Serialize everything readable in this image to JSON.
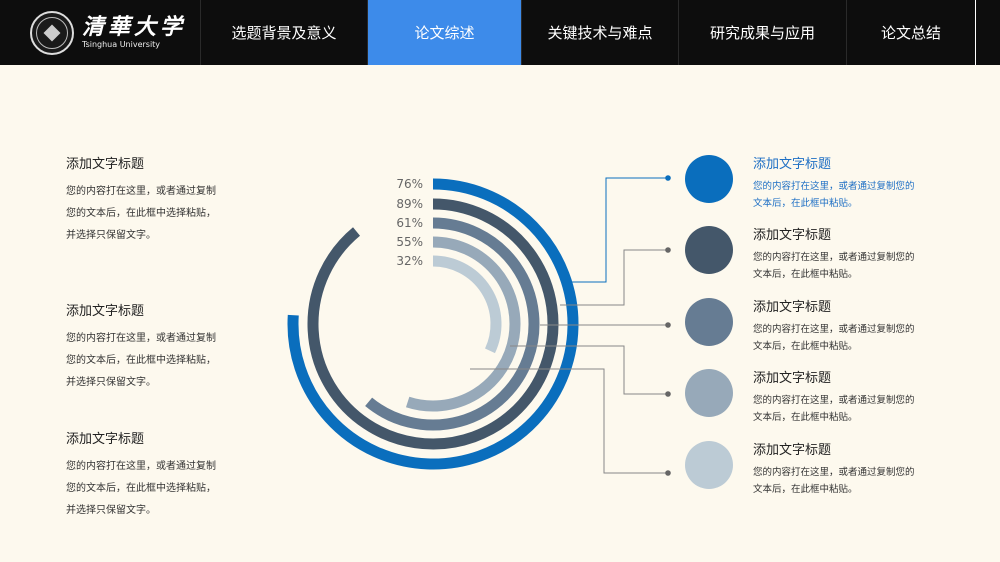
{
  "logo": {
    "cn": "清華大学",
    "en": "Tsinghua University"
  },
  "nav": [
    {
      "label": "选题背景及意义",
      "active": false
    },
    {
      "label": "论文综述",
      "active": true
    },
    {
      "label": "关键技术与难点",
      "active": false
    },
    {
      "label": "研究成果与应用",
      "active": false
    },
    {
      "label": "论文总结",
      "active": false
    }
  ],
  "left_blocks": [
    {
      "title": "添加文字标题",
      "lines": [
        "您的内容打在这里，或者通过复制",
        "您的文本后，在此框中选择粘贴，",
        "并选择只保留文字。"
      ]
    },
    {
      "title": "添加文字标题",
      "lines": [
        "您的内容打在这里，或者通过复制",
        "您的文本后，在此框中选择粘贴，",
        "并选择只保留文字。"
      ]
    },
    {
      "title": "添加文字标题",
      "lines": [
        "您的内容打在这里，或者通过复制",
        "您的文本后，在此框中选择粘贴，",
        "并选择只保留文字。"
      ]
    }
  ],
  "right_items": [
    {
      "title": "添加文字标题",
      "lines": [
        "您的内容打在这里，或者通过复制您的",
        "文本后，在此框中粘贴。"
      ]
    },
    {
      "title": "添加文字标题",
      "lines": [
        "您的内容打在这里，或者通过复制您的",
        "文本后，在此框中粘贴。"
      ]
    },
    {
      "title": "添加文字标题",
      "lines": [
        "您的内容打在这里，或者通过复制您的",
        "文本后，在此框中粘贴。"
      ]
    },
    {
      "title": "添加文字标题",
      "lines": [
        "您的内容打在这里，或者通过复制您的",
        "文本后，在此框中粘贴。"
      ]
    },
    {
      "title": "添加文字标题",
      "lines": [
        "您的内容打在这里，或者通过复制您的",
        "文本后，在此框中粘贴。"
      ]
    }
  ],
  "chart_data": {
    "type": "radial-bar",
    "series": [
      {
        "label": "76%",
        "value": 76,
        "color": "#0a6ebd"
      },
      {
        "label": "89%",
        "value": 89,
        "color": "#44576a"
      },
      {
        "label": "61%",
        "value": 61,
        "color": "#667c93"
      },
      {
        "label": "55%",
        "value": 55,
        "color": "#97a9b9"
      },
      {
        "label": "32%",
        "value": 32,
        "color": "#bccbd5"
      }
    ]
  }
}
